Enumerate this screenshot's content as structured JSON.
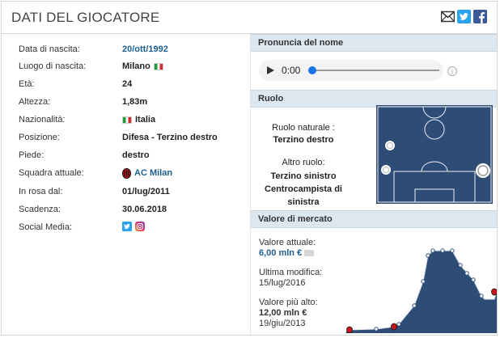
{
  "header": {
    "title": "DATI DEL GIOCATORE"
  },
  "player": {
    "rows": [
      {
        "label": "Data di nascita:",
        "value": "20/ott/1992",
        "link": true,
        "flag": false,
        "club": false
      },
      {
        "label": "Luogo di nascita:",
        "value": "Milano",
        "link": false,
        "flag": true,
        "club": false
      },
      {
        "label": "Età:",
        "value": "24",
        "link": false,
        "flag": false,
        "club": false
      },
      {
        "label": "Altezza:",
        "value": "1,83m",
        "link": false,
        "flag": false,
        "club": false
      },
      {
        "label": "Nazionalità:",
        "value": "Italia",
        "link": false,
        "flag": true,
        "club": false
      },
      {
        "label": "Posizione:",
        "value": "Difesa - Terzino destro",
        "link": false,
        "flag": false,
        "club": false
      },
      {
        "label": "Piede:",
        "value": "destro",
        "link": false,
        "flag": false,
        "club": false
      },
      {
        "label": "Squadra attuale:",
        "value": "AC Milan",
        "link": true,
        "flag": false,
        "club": true
      },
      {
        "label": "In rosa dal:",
        "value": "01/lug/2011",
        "link": false,
        "flag": false,
        "club": false
      },
      {
        "label": "Scadenza:",
        "value": "30.06.2018",
        "link": false,
        "flag": false,
        "club": false
      },
      {
        "label": "Social Media:",
        "value": "",
        "link": false,
        "flag": false,
        "club": false
      }
    ]
  },
  "pronunciation": {
    "title": "Pronuncia del nome",
    "time": "0:00"
  },
  "role": {
    "title": "Ruolo",
    "natural_label": "Ruolo naturale :",
    "natural_value": "Terzino destro",
    "other_label": "Altro ruolo:",
    "other_values": [
      "Terzino sinistro",
      "Centrocampista di",
      "sinistra"
    ]
  },
  "market": {
    "title": "Valore di mercato",
    "current_label": "Valore attuale:",
    "current_value": "6,00 mln €",
    "last_change_label": "Ultima modifica:",
    "last_change_value": "15/lug/2016",
    "highest_label": "Valore più alto:",
    "highest_value": "12,00 mln €",
    "highest_date": "19/giu/2013"
  },
  "colors": {
    "link": "#1d5e91",
    "section_bg": "#dde7f0",
    "chart_fill": "#2d4d77",
    "club_red": "#c4161c"
  }
}
